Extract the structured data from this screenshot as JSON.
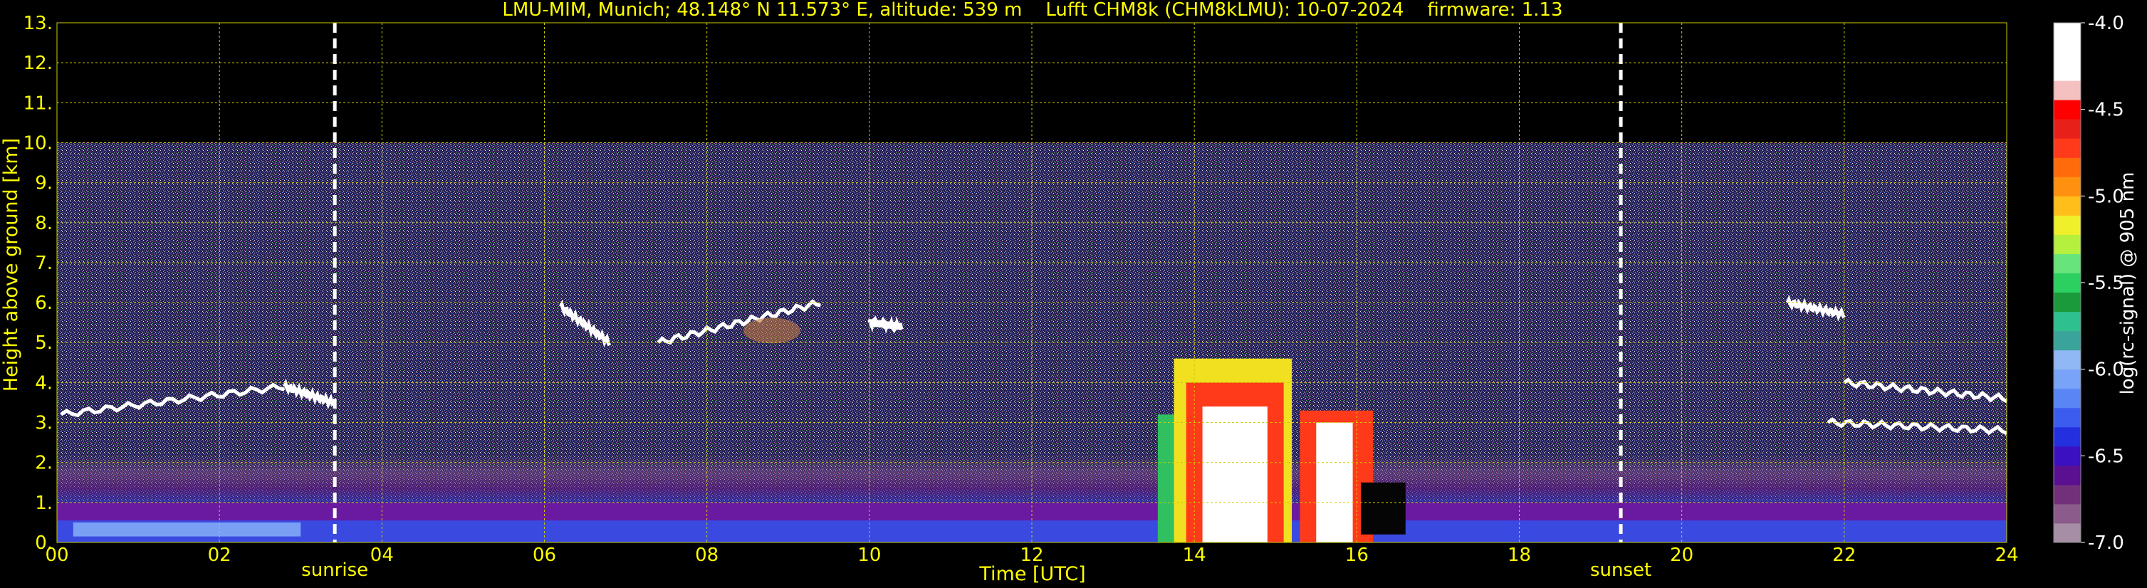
{
  "chart_data": {
    "type": "heatmap",
    "title": "LMU-MIM, Munich; 48.148° N 11.573° E, altitude: 539 m    Lufft CHM8k (CHM8kLMU): 10-07-2024    firmware: 1.13",
    "xlabel": "Time [UTC]",
    "ylabel": "Height above ground [km]",
    "xlim": [
      0,
      24
    ],
    "ylim": [
      0,
      13
    ],
    "x_ticks": [
      "00",
      "02",
      "04",
      "06",
      "08",
      "10",
      "12",
      "14",
      "16",
      "18",
      "20",
      "22",
      "24"
    ],
    "y_ticks": [
      "0.",
      "1.",
      "2.",
      "3.",
      "4.",
      "5.",
      "6.",
      "7.",
      "8.",
      "9.",
      "10.",
      "11.",
      "12.",
      "13."
    ],
    "grid": true,
    "data_ceiling_km": 10,
    "events": [
      {
        "label": "sunrise",
        "time": 3.42
      },
      {
        "label": "sunset",
        "time": 19.25
      }
    ],
    "colorbar": {
      "label": "log(rc-signal) @ 905 nm",
      "ticks": [
        "-4.0",
        "-4.5",
        "-5.0",
        "-5.5",
        "-6.0",
        "-6.5",
        "-7.0"
      ],
      "range": [
        -7.0,
        -4.0
      ],
      "colors": [
        "#a68fa6",
        "#8b5c8b",
        "#73307a",
        "#5a1090",
        "#3b10c0",
        "#2430e0",
        "#3c5cf0",
        "#5a85f5",
        "#79a3f7",
        "#8fb8f5",
        "#3aa39a",
        "#2fc090",
        "#1a9a3a",
        "#2bd060",
        "#67e57a",
        "#b6f03f",
        "#f0f02a",
        "#ffbe1a",
        "#ff9010",
        "#ff6a0a",
        "#ff3a1a",
        "#e8201a",
        "#ff0000",
        "#f5c0c0",
        "#ffffff",
        "#ffffff",
        "#ffffff"
      ]
    },
    "features": [
      {
        "name": "boundary layer",
        "x": [
          0,
          24
        ],
        "top_km": [
          1.0,
          1.2
        ]
      },
      {
        "name": "cloud layer",
        "x": [
          0,
          3.5
        ],
        "y_km": [
          3.0,
          4.0
        ]
      },
      {
        "name": "cloud layer",
        "x": [
          6.0,
          9.4
        ],
        "y_km": [
          5.0,
          6.0
        ]
      },
      {
        "name": "cloud layer",
        "x": [
          10.0,
          10.4
        ],
        "y_km": [
          5.4
        ]
      },
      {
        "name": "convective cloud / precipitation",
        "x": [
          13.5,
          16.5
        ],
        "y_km": [
          0,
          5.0
        ]
      },
      {
        "name": "cloud layer",
        "x": [
          21.3,
          24
        ],
        "y_km": [
          3.0,
          6.0
        ]
      }
    ]
  }
}
